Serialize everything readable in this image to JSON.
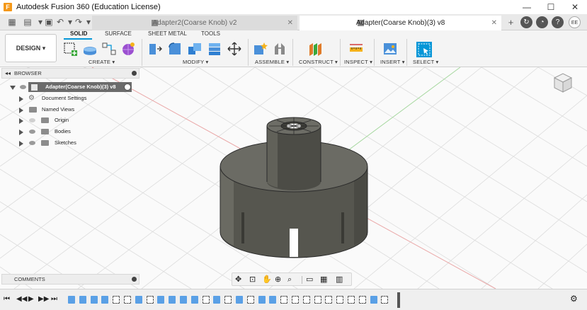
{
  "window": {
    "title": "Autodesk Fusion 360 (Education License)",
    "logo_letter": "F",
    "controls": [
      "—",
      "☐",
      "✕"
    ]
  },
  "tabs": [
    {
      "label": "Adapter2(Coarse Knob) v2",
      "active": false
    },
    {
      "label": "Adapter(Coarse Knob)(3) v8",
      "active": true
    }
  ],
  "user_initials": "EE",
  "toolbar": {
    "workspace": "DESIGN",
    "workspace_tabs": [
      "SOLID",
      "SURFACE",
      "SHEET METAL",
      "TOOLS"
    ],
    "groups": [
      "CREATE",
      "MODIFY",
      "ASSEMBLE",
      "CONSTRUCT",
      "INSERT",
      "INSPECT",
      "SELECT"
    ]
  },
  "browser": {
    "header": "BROWSER",
    "root": "Adapter(Coarse Knob)(3) v8",
    "items": [
      "Document Settings",
      "Named Views",
      "Origin",
      "Bodies",
      "Sketches"
    ]
  },
  "comments": {
    "header": "COMMENTS"
  },
  "colors": {
    "accent": "#0696d7",
    "model_body": "#5b5b55",
    "model_top": "#6d6d66",
    "grid": "#dcdcdc",
    "axis_red": "#e7a7a7",
    "axis_green": "#a7d8a0",
    "timeline_feature": "#5aa0e6"
  }
}
